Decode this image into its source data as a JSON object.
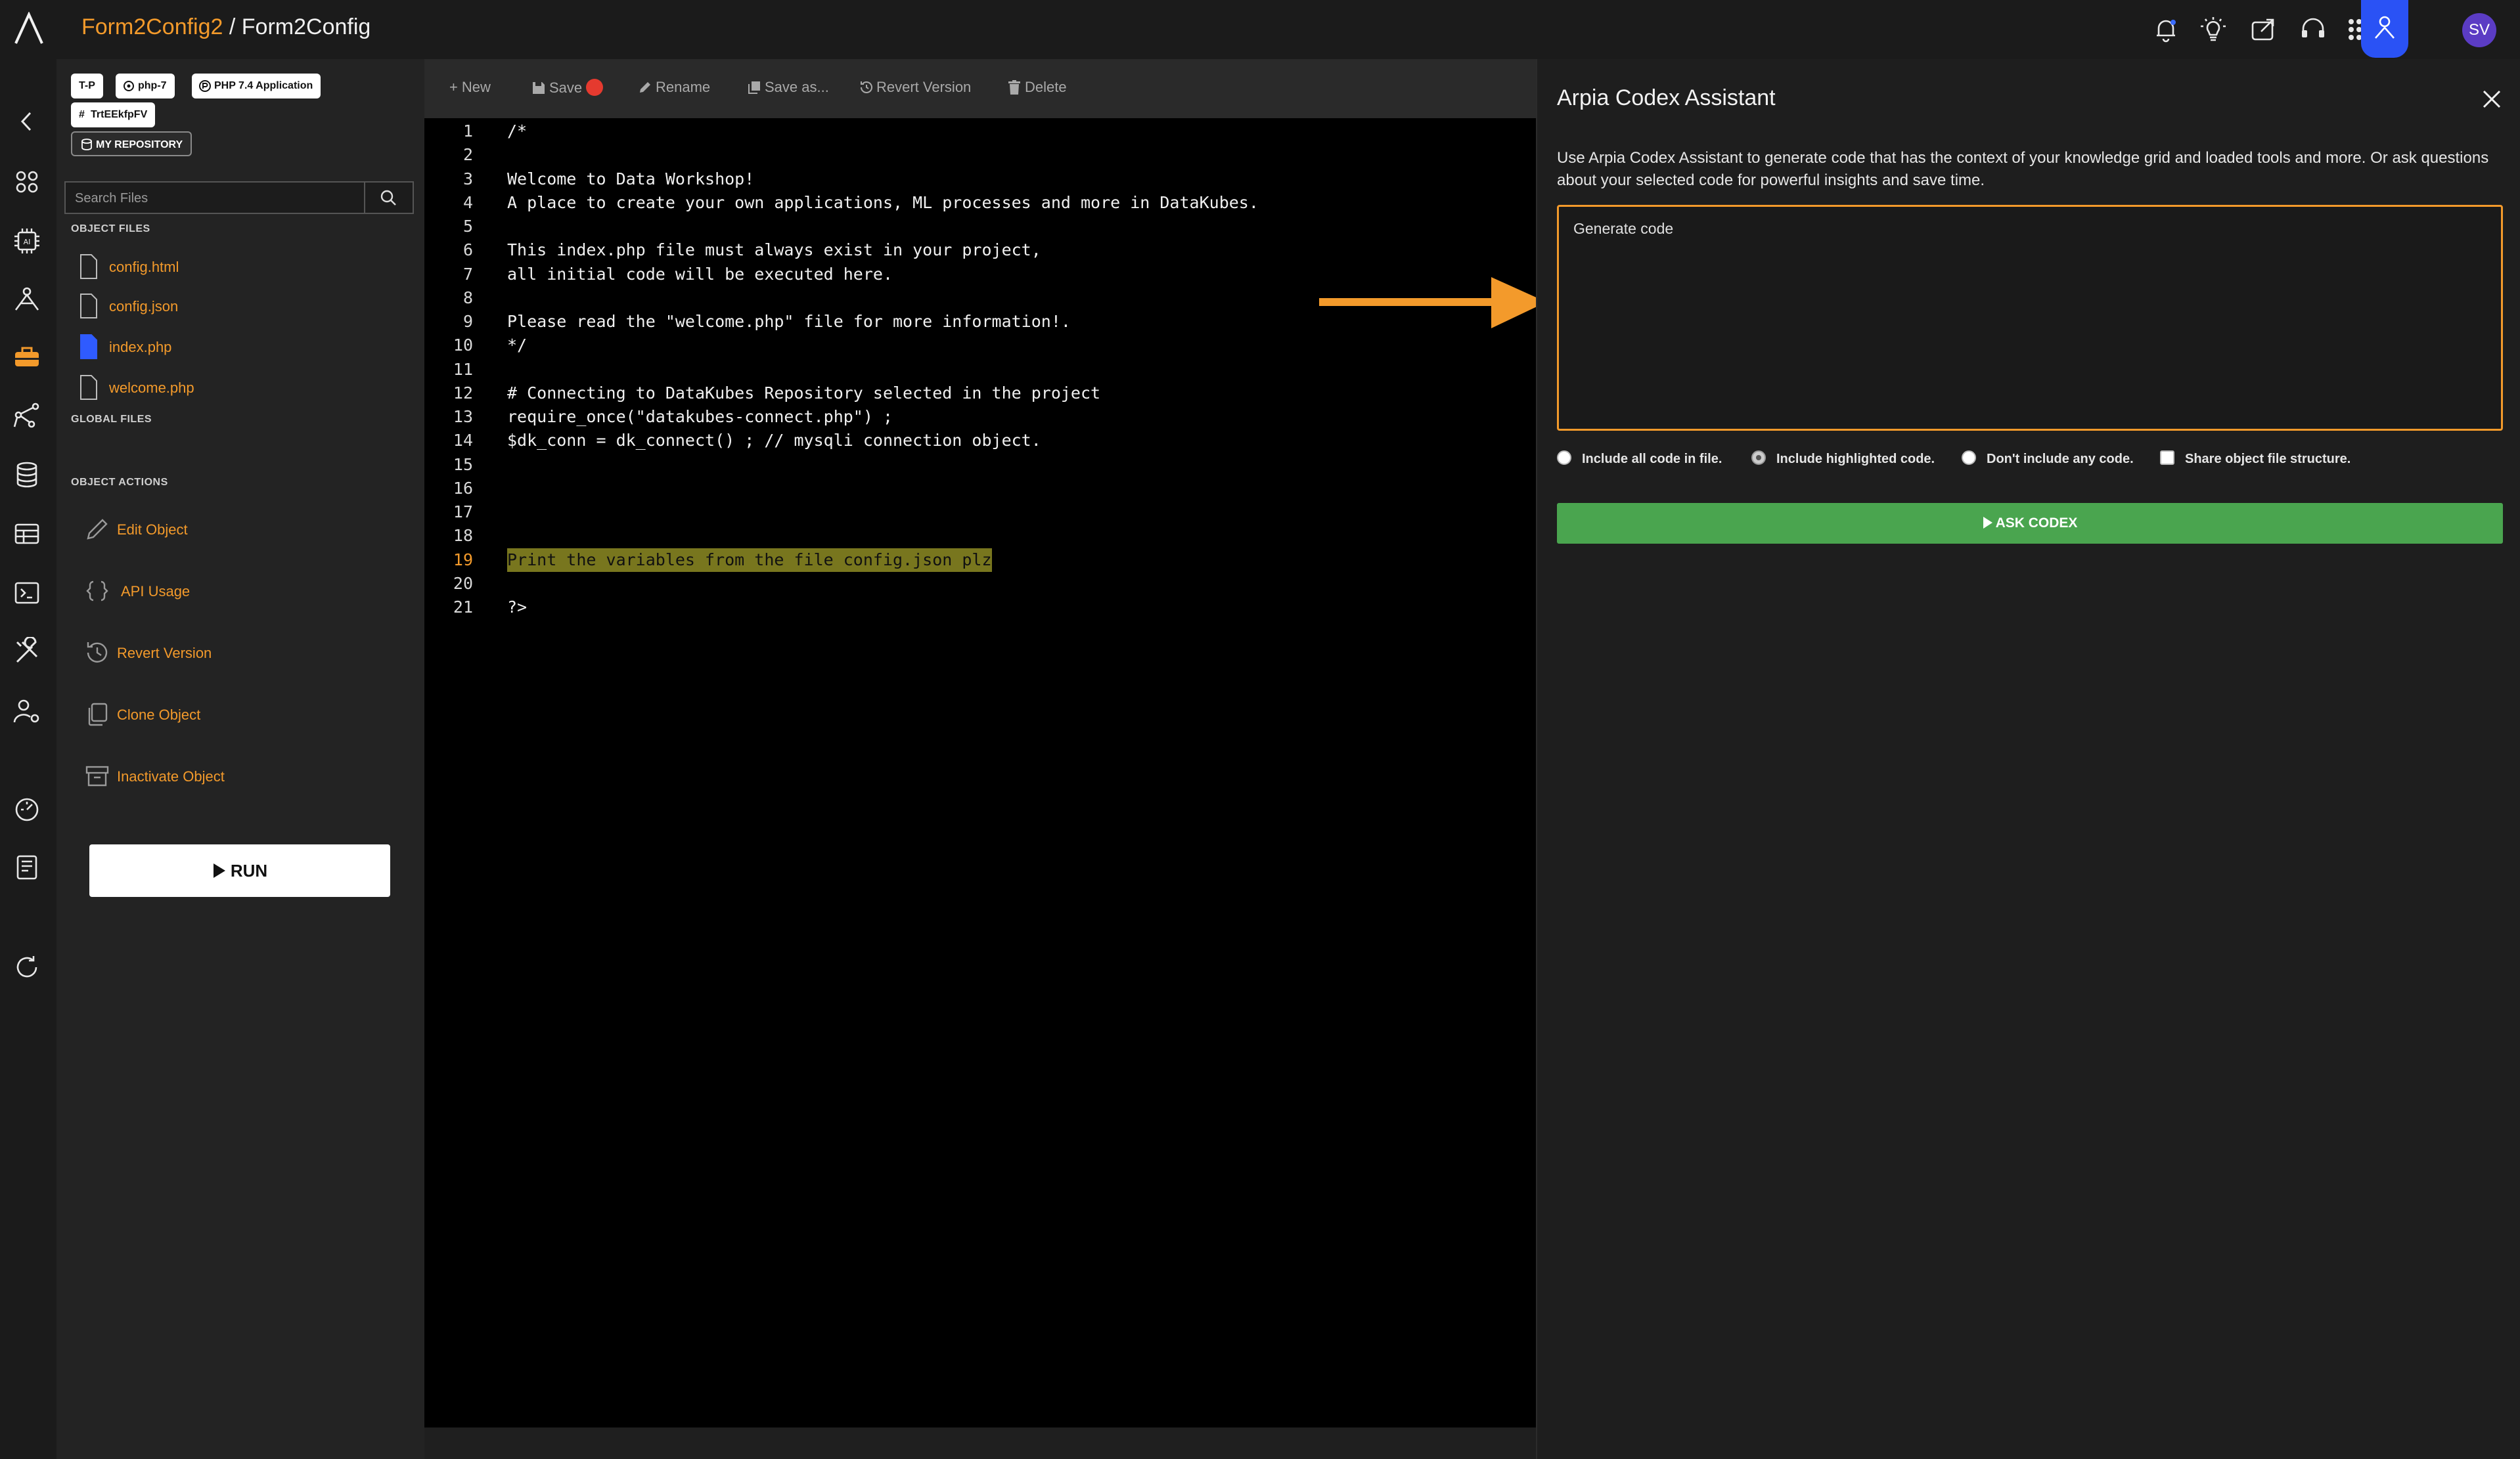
{
  "header": {
    "project": "Form2Config2",
    "separator": "/",
    "object": "Form2Config",
    "user_initials": "SV",
    "icons": [
      "bell-icon",
      "lightbulb-icon",
      "share-icon",
      "support-icon",
      "apps-grid-icon",
      "assistant-icon"
    ]
  },
  "rail": {
    "icons": [
      "back-icon",
      "apps-icon",
      "ai-chip-icon",
      "network-icon",
      "toolbox-icon",
      "share-nodes-icon",
      "database-icon",
      "table-icon",
      "terminal-icon",
      "tools-icon",
      "user-settings-icon",
      "dashboard-icon",
      "book-icon",
      "refresh-icon"
    ]
  },
  "sidebar": {
    "tags": [
      "T-P",
      "php-7",
      "PHP 7.4 Application",
      "TrtEEkfpFV"
    ],
    "repo_tag": "MY REPOSITORY",
    "search_placeholder": "Search Files",
    "object_files_heading": "OBJECT FILES",
    "files": [
      "config.html",
      "config.json",
      "index.php",
      "welcome.php"
    ],
    "global_files_heading": "GLOBAL FILES",
    "object_actions_heading": "OBJECT ACTIONS",
    "actions": [
      "Edit Object",
      "API Usage",
      "Revert Version",
      "Clone Object",
      "Inactivate Object"
    ],
    "run_label": "RUN"
  },
  "toolbar": {
    "new_label": "New",
    "save_label": "Save",
    "rename_label": "Rename",
    "save_as_label": "Save as...",
    "revert_label": "Revert Version",
    "delete_label": "Delete"
  },
  "editor": {
    "highlighted_line": 19,
    "lines": [
      "/*",
      "",
      "Welcome to Data Workshop!",
      "A place to create your own applications, ML processes and more in DataKubes.",
      "",
      "This index.php file must always exist in your project,",
      "all initial code will be executed here.",
      "",
      "Please read the \"welcome.php\" file for more information!.",
      "*/",
      "",
      "# Connecting to DataKubes Repository selected in the project",
      "require_once(\"datakubes-connect.php\") ;",
      "$dk_conn = dk_connect() ; // mysqli connection object.",
      "",
      "",
      "",
      "",
      "Print the variables from the file config.json plz",
      "",
      "?>"
    ]
  },
  "assistant": {
    "title": "Arpia Codex Assistant",
    "description": "Use Arpia Codex Assistant to generate code that has the context of your knowledge grid and loaded tools and more. Or ask questions about your selected code for powerful insights and save time.",
    "prompt_placeholder": "Generate code",
    "options": {
      "include_all": "Include all code in file.",
      "include_highlighted": "Include highlighted code.",
      "include_none": "Don't include any code.",
      "share_structure": "Share object file structure."
    },
    "ask_label": "ASK CODEX"
  },
  "colors": {
    "accent": "#f39a2b",
    "assistant_active": "#2a52f5",
    "ask_button": "#4aa54f",
    "save_indicator": "#e53a2f",
    "selection": "#78761e"
  }
}
